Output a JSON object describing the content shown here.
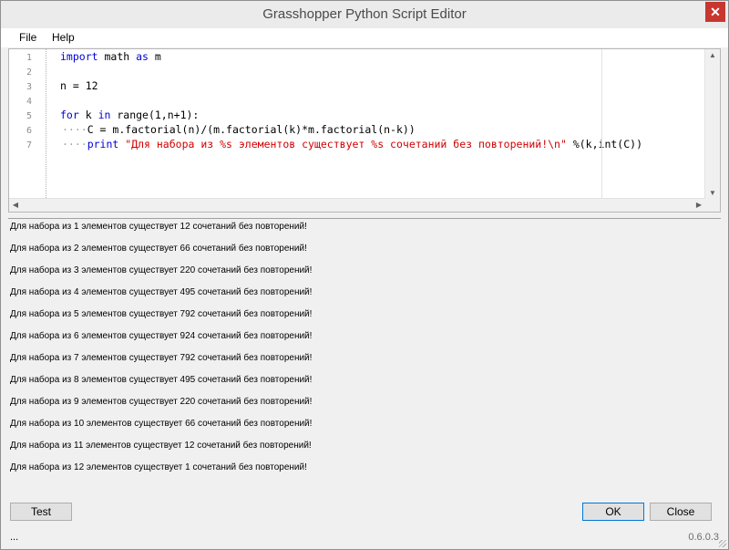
{
  "window": {
    "title": "Grasshopper Python Script Editor",
    "close_glyph": "✕"
  },
  "menu": {
    "items": [
      "File",
      "Help"
    ]
  },
  "editor": {
    "line_numbers": [
      "1",
      "2",
      "3",
      "4",
      "5",
      "6",
      "7"
    ],
    "lines": [
      {
        "kw": "import",
        "rest1": " math ",
        "kw2": "as",
        "rest2": " m"
      },
      {
        "text": ""
      },
      {
        "text": "n = 12"
      },
      {
        "kw": "for",
        "rest1": " k ",
        "kw2": "in",
        "rest2": " range(1,n+1):"
      },
      {
        "indent": "····",
        "text": "C = m.factorial(n)/(m.factorial(k)*m.factorial(n-k))"
      },
      {
        "indent": "····",
        "kw": "print",
        "str": " \"Для набора из %s элементов существует %s сочетаний без повторений!\\n\"",
        "rest": " %(k,int(C))"
      }
    ]
  },
  "output": {
    "lines": [
      "Для набора из 1 элементов существует 12 сочетаний без повторений!",
      "Для набора из 2 элементов существует 66 сочетаний без повторений!",
      "Для набора из 3 элементов существует 220 сочетаний без повторений!",
      "Для набора из 4 элементов существует 495 сочетаний без повторений!",
      "Для набора из 5 элементов существует 792 сочетаний без повторений!",
      "Для набора из 6 элементов существует 924 сочетаний без повторений!",
      "Для набора из 7 элементов существует 792 сочетаний без повторений!",
      "Для набора из 8 элементов существует 495 сочетаний без повторений!",
      "Для набора из 9 элементов существует 220 сочетаний без повторений!",
      "Для набора из 10 элементов существует 66 сочетаний без повторений!",
      "Для набора из 11 элементов существует 12 сочетаний без повторений!",
      "Для набора из 12 элементов существует 1 сочетаний без повторений!"
    ]
  },
  "buttons": {
    "test": "Test",
    "ok": "OK",
    "close": "Close"
  },
  "status": {
    "left": "...",
    "version": "0.6.0.3"
  },
  "colors": {
    "keyword": "#0000d8",
    "string": "#d00000",
    "close_button": "#c7372f",
    "ok_border": "#0078d7"
  }
}
